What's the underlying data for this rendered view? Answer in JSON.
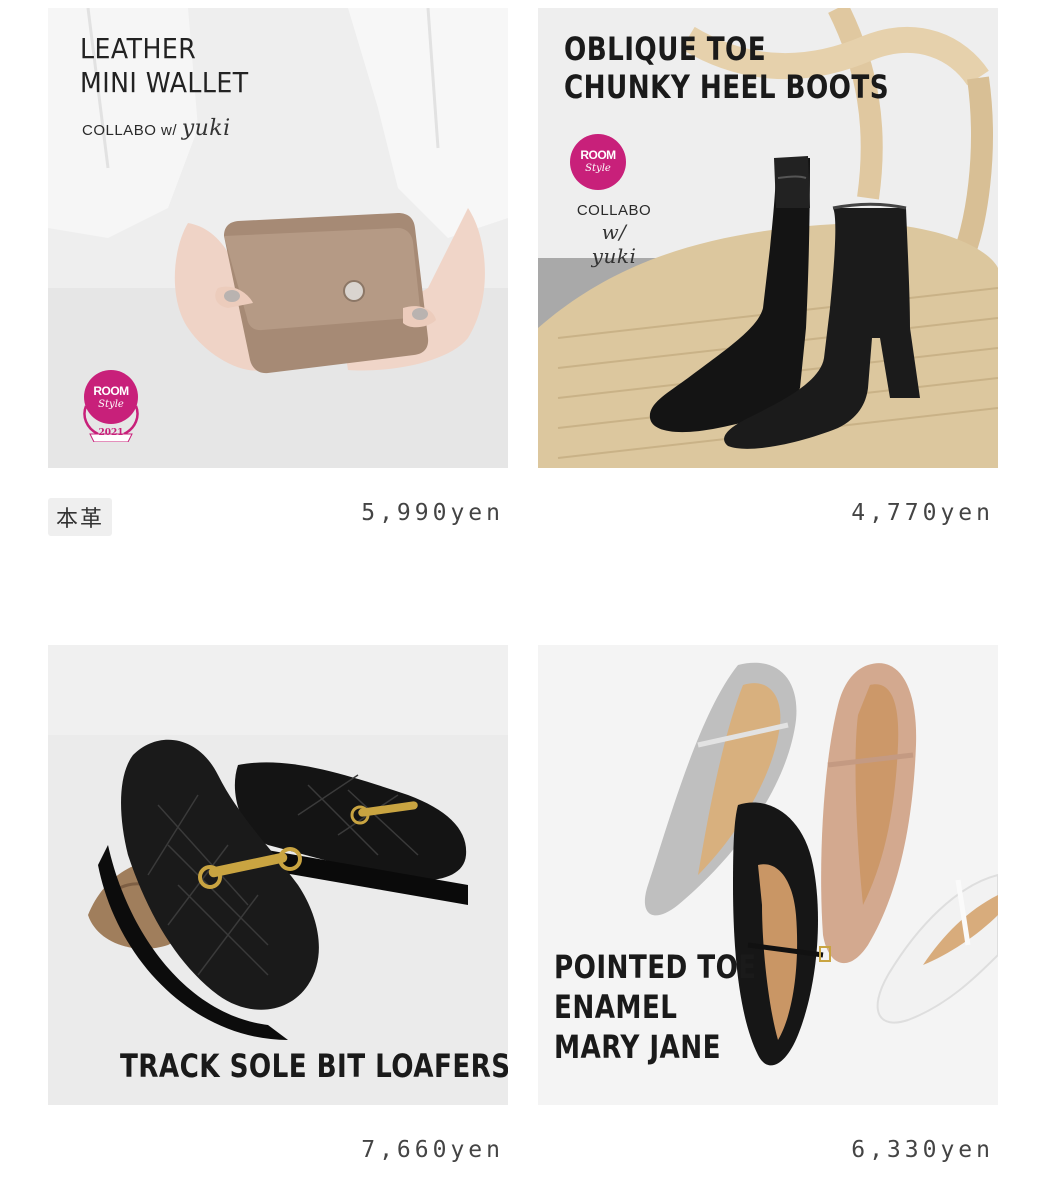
{
  "products": [
    {
      "headline": [
        "LEATHER",
        "MINI WALLET"
      ],
      "collab_prefix": "COLLABO w/",
      "collab_name": "yuki",
      "badge": {
        "room": "ROOM",
        "style": "Style",
        "year": "2021"
      },
      "tag": "本革",
      "price": "5,990yen"
    },
    {
      "headline": [
        "OBLIQUE TOE",
        "CHUNKY HEEL BOOTS"
      ],
      "collab_prefix": "COLLABO",
      "collab_w": "w/",
      "collab_name": "yuki",
      "badge": {
        "room": "ROOM",
        "style": "Style"
      },
      "price": "4,770yen"
    },
    {
      "headline": [
        "TRACK SOLE BIT LOAFERS"
      ],
      "price": "7,660yen"
    },
    {
      "headline": [
        "POINTED TOE",
        "ENAMEL",
        "MARY JANE"
      ],
      "price": "6,330yen"
    }
  ],
  "colors": {
    "badge": "#c8207a",
    "tag_bg": "#efefef",
    "price_text": "#444444"
  }
}
